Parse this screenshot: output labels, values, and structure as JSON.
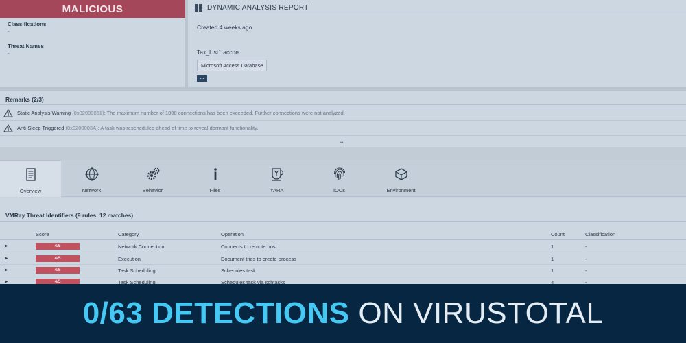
{
  "verdict": {
    "label": "MALICIOUS",
    "classifications_label": "Classifications",
    "classifications_value": "-",
    "threat_names_label": "Threat Names",
    "threat_names_value": "-"
  },
  "report": {
    "title": "DYNAMIC ANALYSIS REPORT",
    "created": "Created 4 weeks ago",
    "filename": "Tax_List1.accde",
    "file_type": "Microsoft Access Database",
    "more_label": "..."
  },
  "remarks": {
    "title": "Remarks (2/3)",
    "items": [
      {
        "name": "Static Analysis Warning",
        "code": "(0x02000051)",
        "desc": ": The maximum number of 1000 connections has been exceeded. Further connections were not analyzed."
      },
      {
        "name": "Anti-Sleep Triggered",
        "code": "(0x0200003A)",
        "desc": ": A task was rescheduled ahead of time to reveal dormant functionality."
      }
    ],
    "chevron": "⌄"
  },
  "tabs": [
    {
      "label": "Overview",
      "icon": "document-icon"
    },
    {
      "label": "Network",
      "icon": "globe-network-icon"
    },
    {
      "label": "Behavior",
      "icon": "gears-icon"
    },
    {
      "label": "Files",
      "icon": "info-icon"
    },
    {
      "label": "YARA",
      "icon": "yara-icon"
    },
    {
      "label": "IOCs",
      "icon": "fingerprint-icon"
    },
    {
      "label": "Environment",
      "icon": "cube-icon"
    }
  ],
  "vti": {
    "title": "VMRay Threat Identifiers (9 rules, 12 matches)",
    "headers": {
      "score": "Score",
      "category": "Category",
      "operation": "Operation",
      "count": "Count",
      "classification": "Classification"
    },
    "rows": [
      {
        "score": "4/5",
        "category": "Network Connection",
        "operation": "Connects to remote host",
        "count": "1",
        "classification": "-"
      },
      {
        "score": "4/5",
        "category": "Execution",
        "operation": "Document tries to create process",
        "count": "1",
        "classification": "-"
      },
      {
        "score": "4/5",
        "category": "Task Scheduling",
        "operation": "Schedules task",
        "count": "1",
        "classification": "-"
      },
      {
        "score": "4/5",
        "category": "Task Scheduling",
        "operation": "Schedules task via schtasks",
        "count": "4",
        "classification": "-"
      }
    ]
  },
  "banner": {
    "strong": "0/63 DETECTIONS",
    "light": " ON VIRUSTOTAL"
  },
  "colors": {
    "verdict_bg": "#a5475a",
    "score_bg": "#c0515f",
    "banner_bg": "#062642",
    "banner_accent": "#46c8f4"
  }
}
